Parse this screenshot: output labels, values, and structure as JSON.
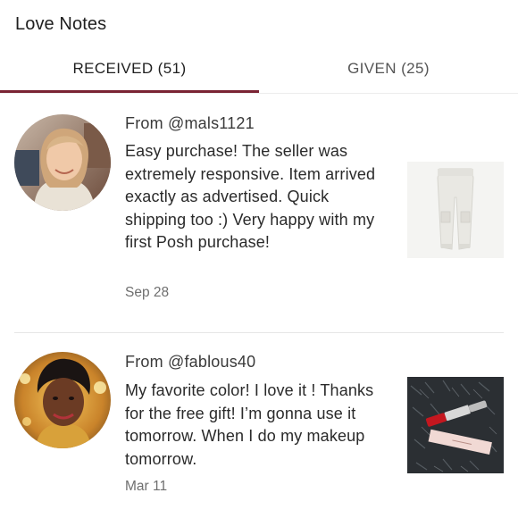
{
  "header": {
    "title": "Love Notes"
  },
  "tabs": [
    {
      "label": "RECEIVED (51)",
      "active": true
    },
    {
      "label": "GIVEN (25)",
      "active": false
    }
  ],
  "accent_color": "#7a2333",
  "notes": [
    {
      "from": "From @mals1121",
      "text": "Easy purchase! The seller was extremely responsive. Item arrived exactly as advertised. Quick shipping too :) Very happy with my first Posh purchase!",
      "date": "Sep 28",
      "avatar_icon": "user-avatar-photo",
      "item_image": "white-cargo-pants-photo"
    },
    {
      "from": "From @fablous40",
      "text": "My favorite color! I love it ! Thanks for the free gift! I’m gonna use it tomorrow. When I do my makeup tomorrow.",
      "date": "Mar 11",
      "avatar_icon": "user-avatar-photo",
      "item_image": "lipstick-on-fur-photo"
    }
  ]
}
